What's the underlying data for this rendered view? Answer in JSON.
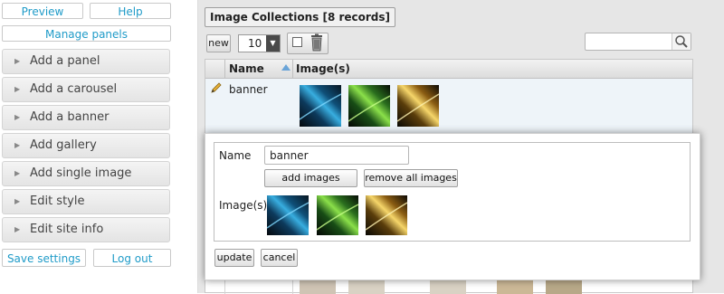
{
  "sidebar": {
    "preview_label": "Preview",
    "help_label": "Help",
    "manage_panels_label": "Manage panels",
    "items": [
      {
        "label": "Add a panel"
      },
      {
        "label": "Add a carousel"
      },
      {
        "label": "Add a banner"
      },
      {
        "label": "Add gallery"
      },
      {
        "label": "Add single image"
      },
      {
        "label": "Edit style"
      },
      {
        "label": "Edit site info"
      }
    ],
    "save_settings_label": "Save settings",
    "log_out_label": "Log out"
  },
  "collection": {
    "title": "Image Collections [8 records]",
    "new_label": "new",
    "page_size": "10",
    "search_placeholder": "",
    "columns": {
      "name": "Name",
      "images": "Image(s)"
    },
    "rows": [
      {
        "name": "banner",
        "thumbnails": [
          "blue-lights-thumb",
          "green-lights-thumb",
          "gold-lights-thumb"
        ]
      }
    ]
  },
  "editor": {
    "name_label": "Name",
    "name_value": "banner",
    "add_images_label": "add images",
    "remove_all_label": "remove all images",
    "images_label": "Image(s)",
    "update_label": "update",
    "cancel_label": "cancel"
  },
  "colors": {
    "link_blue": "#1f9bc8",
    "row_highlight": "#eef4f9",
    "sort_arrow": "#6aa4d8"
  }
}
